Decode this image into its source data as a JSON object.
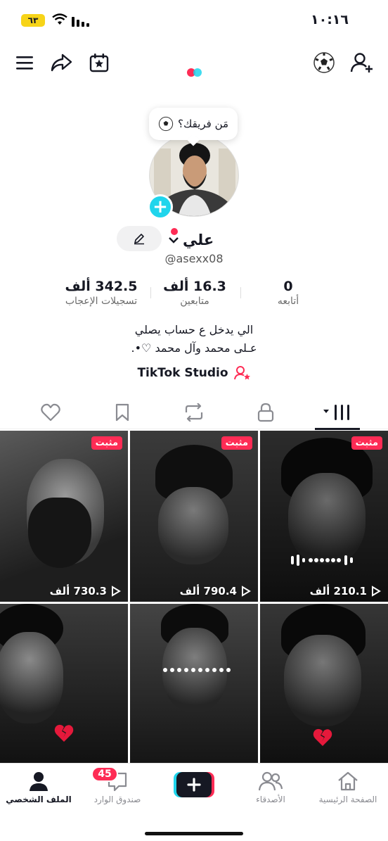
{
  "status_bar": {
    "time": "١٠:١٦",
    "battery": "٦٣"
  },
  "top_bar": {
    "icons": [
      "menu-icon",
      "share-icon",
      "calendar-star-icon",
      "soccer-ball-icon",
      "add-friend-icon"
    ]
  },
  "team_bubble": {
    "text": "مَن فريقك؟"
  },
  "profile": {
    "name": "علي",
    "username": "@asexx08"
  },
  "stats": [
    {
      "value": "0",
      "label": "أتابعه"
    },
    {
      "value": "16.3 ألف",
      "label": "متابعين"
    },
    {
      "value": "342.5 ألف",
      "label": "تسجيلات الإعجاب"
    }
  ],
  "bio": {
    "line1": "الي يدخل ع حساب يصلي",
    "line2": "ﻋـلى محمد وآل محمد ♡•."
  },
  "studio": {
    "label": "TikTok Studio"
  },
  "tabs": [
    "videos-tab",
    "private-tab",
    "reposts-tab",
    "favorites-tab",
    "liked-tab"
  ],
  "videos": [
    {
      "pinned": "مثبت",
      "views": "730.3 ألف"
    },
    {
      "pinned": "مثبت",
      "views": "790.4 ألف"
    },
    {
      "pinned": "مثبت",
      "views": "210.1 ألف"
    },
    {
      "views": ""
    },
    {
      "views": ""
    },
    {
      "views": ""
    }
  ],
  "bottom_nav": {
    "profile": "الملف الشخصي",
    "inbox": "صندوق الوارد",
    "inbox_badge": "45",
    "friends": "الأصدقاء",
    "home": "الصفحة الرئيسية"
  },
  "colors": {
    "accent": "#fe2c55",
    "cyan": "#20d5ec",
    "text": "#161823"
  }
}
